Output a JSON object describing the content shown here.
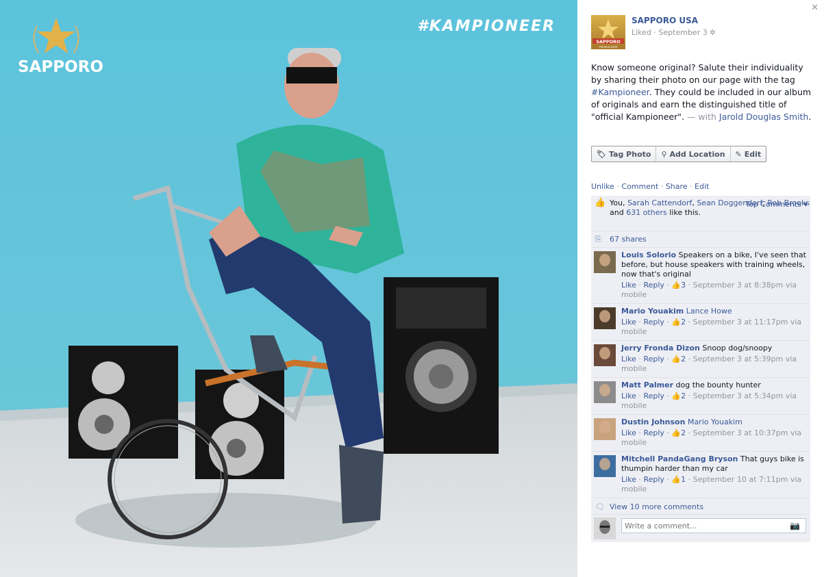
{
  "photo": {
    "brand_logo_text": "SAPPORO",
    "hashtag": "#KAMPIONEER",
    "colors": {
      "wall": "#5dbfd8",
      "sidewalk": "#d9dde0",
      "shirt": "#2fb39a",
      "bike": "#c8722a"
    }
  },
  "side": {
    "close_icon": "close-icon",
    "page_name": "SAPPORO USA",
    "thumb_lettering": "SAPPORO PREMIUM BEER",
    "liked_label": "Liked",
    "date": "September 3",
    "post_text_main": "Know someone original? Salute their individuality by sharing their photo on our page with the tag ",
    "post_tag": "#Kampioneer",
    "post_text_rest": ". They could be included in our album of originals and earn the distinguished title of \"official Kampioneer\".",
    "with_text": " — with ",
    "with_name": "Jarold Douglas Smith",
    "actions": {
      "tag_photo": "Tag Photo",
      "add_location": "Add Location",
      "edit": "Edit"
    },
    "ufi_links": {
      "unlike": "Unlike",
      "comment": "Comment",
      "share": "Share",
      "edit": "Edit"
    },
    "likes": {
      "you": "You, ",
      "names": [
        "Sarah Cattendorf",
        "Sean Doggendorf",
        "Rob Brooks"
      ],
      "and": " and ",
      "others": "631 others",
      "suffix": " like this."
    },
    "top_comments": "Top Comments ▾",
    "shares": "67 shares",
    "comments": [
      {
        "name": "Louis Solorio",
        "tag": "",
        "text": "Speakers on a bike, I've seen that before, but house speakers with training wheels, now that's original",
        "likes": "3",
        "time": "September 3 at 8:38pm via mobile"
      },
      {
        "name": "Mario Youakim",
        "tag": "Lance Howe",
        "text": "",
        "likes": "2",
        "time": "September 3 at 11:17pm via mobile"
      },
      {
        "name": "Jerry Fronda Dizon",
        "tag": "",
        "text": "Snoop dog/snoopy",
        "likes": "2",
        "time": "September 3 at 5:39pm via mobile"
      },
      {
        "name": "Matt Palmer",
        "tag": "",
        "text": "dog the bounty hunter",
        "likes": "2",
        "time": "September 3 at 5:34pm via mobile"
      },
      {
        "name": "Dustin Johnson",
        "tag": "Mario Youakim",
        "text": "",
        "likes": "2",
        "time": "September 3 at 10:37pm via mobile"
      },
      {
        "name": "Mitchell PandaGang Bryson",
        "tag": "",
        "text": "That guys bike is thumpin harder than my car",
        "likes": "1",
        "time": "September 10 at 7:11pm via mobile"
      }
    ],
    "like_label": "Like",
    "reply_label": "Reply",
    "view_more": "View 10 more comments",
    "comment_placeholder": "Write a comment..."
  }
}
